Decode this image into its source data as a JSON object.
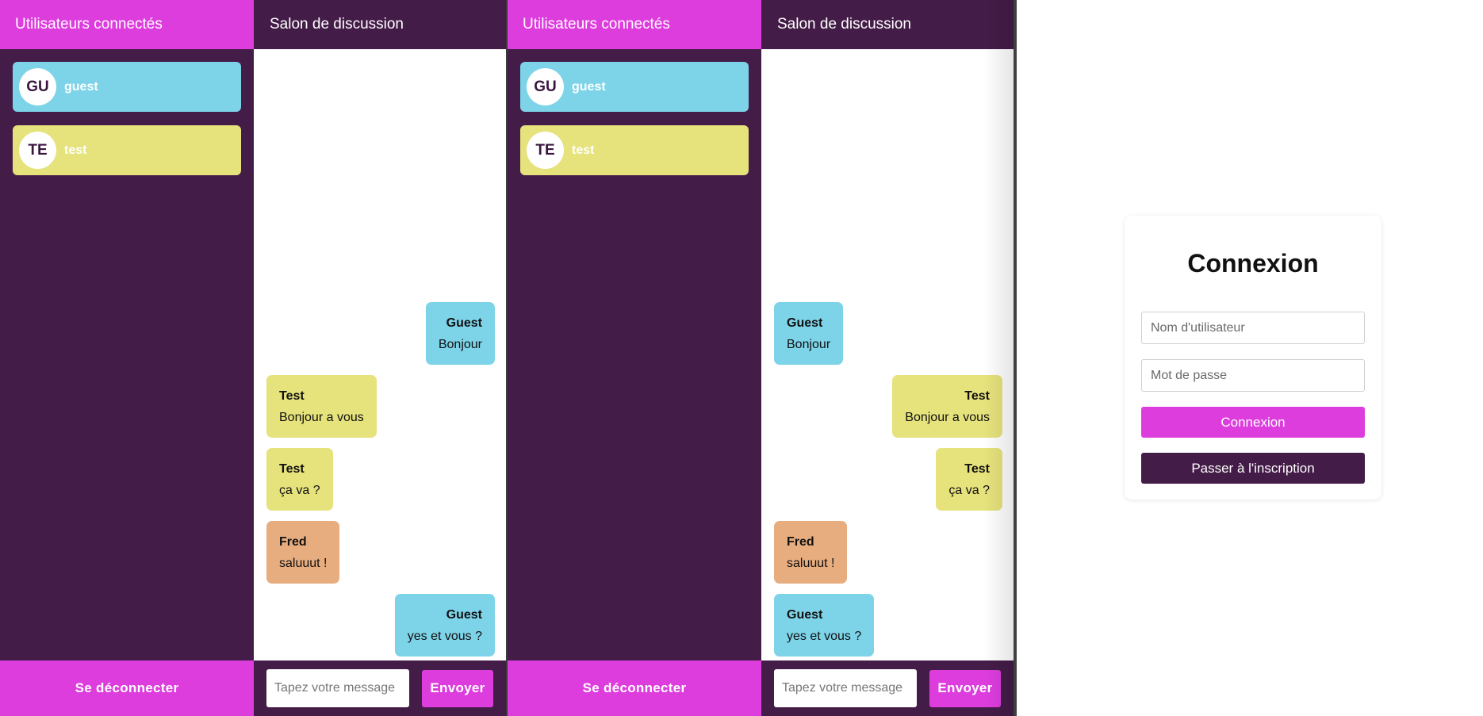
{
  "colors": {
    "magenta": "#dd3ddd",
    "purple_dark": "#441c48",
    "user_blue": "#7dd3e8",
    "user_yellow": "#e6e27c",
    "user_orange": "#e8ad7f"
  },
  "panels": [
    {
      "sidebar": {
        "title": "Utilisateurs connectés",
        "users": [
          {
            "initials": "GU",
            "name": "guest",
            "color": "#7dd3e8"
          },
          {
            "initials": "TE",
            "name": "test",
            "color": "#e6e27c"
          }
        ],
        "logout_label": "Se déconnecter"
      },
      "chat": {
        "title": "Salon de discussion",
        "messages": [
          {
            "author": "Guest",
            "text": "Bonjour",
            "color": "#7dd3e8",
            "side": "right"
          },
          {
            "author": "Test",
            "text": "Bonjour a vous",
            "color": "#e6e27c",
            "side": "left"
          },
          {
            "author": "Test",
            "text": "ça va ?",
            "color": "#e6e27c",
            "side": "left"
          },
          {
            "author": "Fred",
            "text": "saluuut !",
            "color": "#e8ad7f",
            "side": "left"
          },
          {
            "author": "Guest",
            "text": "yes et vous ?",
            "color": "#7dd3e8",
            "side": "right"
          }
        ],
        "input_placeholder": "Tapez votre message",
        "send_label": "Envoyer"
      }
    },
    {
      "sidebar": {
        "title": "Utilisateurs connectés",
        "users": [
          {
            "initials": "GU",
            "name": "guest",
            "color": "#7dd3e8"
          },
          {
            "initials": "TE",
            "name": "test",
            "color": "#e6e27c"
          }
        ],
        "logout_label": "Se déconnecter"
      },
      "chat": {
        "title": "Salon de discussion",
        "messages": [
          {
            "author": "Guest",
            "text": "Bonjour",
            "color": "#7dd3e8",
            "side": "left"
          },
          {
            "author": "Test",
            "text": "Bonjour a vous",
            "color": "#e6e27c",
            "side": "right"
          },
          {
            "author": "Test",
            "text": "ça va ?",
            "color": "#e6e27c",
            "side": "right"
          },
          {
            "author": "Fred",
            "text": "saluuut !",
            "color": "#e8ad7f",
            "side": "left"
          },
          {
            "author": "Guest",
            "text": "yes et vous ?",
            "color": "#7dd3e8",
            "side": "left"
          }
        ],
        "input_placeholder": "Tapez votre message",
        "send_label": "Envoyer"
      }
    }
  ],
  "login": {
    "title": "Connexion",
    "username_placeholder": "Nom d'utilisateur",
    "password_placeholder": "Mot de passe",
    "submit_label": "Connexion",
    "register_label": "Passer à l'inscription"
  }
}
